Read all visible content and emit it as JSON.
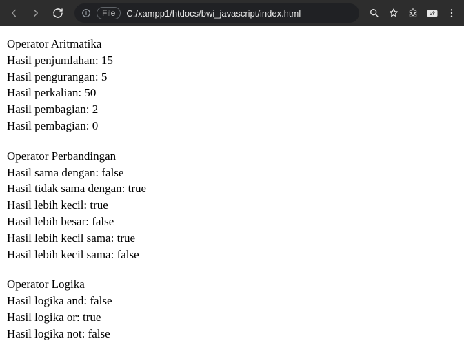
{
  "browser": {
    "scheme": "File",
    "url": "C:/xampp1/htdocs/bwi_javascript/index.html"
  },
  "sections": {
    "arithmetic": {
      "title": "Operator Aritmatika",
      "sum": "Hasil penjumlahan: 15",
      "sub": "Hasil pengurangan: 5",
      "mul": "Hasil perkalian: 50",
      "div": "Hasil pembagian: 2",
      "mod": "Hasil pembagian: 0"
    },
    "comparison": {
      "title": "Operator Perbandingan",
      "eq": "Hasil sama dengan: false",
      "neq": "Hasil tidak sama dengan: true",
      "lt": "Hasil lebih kecil: true",
      "gt": "Hasil lebih besar: false",
      "lte": "Hasil lebih kecil sama: true",
      "gte": "Hasil lebih kecil sama: false"
    },
    "logic": {
      "title": "Operator Logika",
      "and": "Hasil logika and: false",
      "or": "Hasil logika or: true",
      "not": "Hasil logika not: false"
    }
  }
}
